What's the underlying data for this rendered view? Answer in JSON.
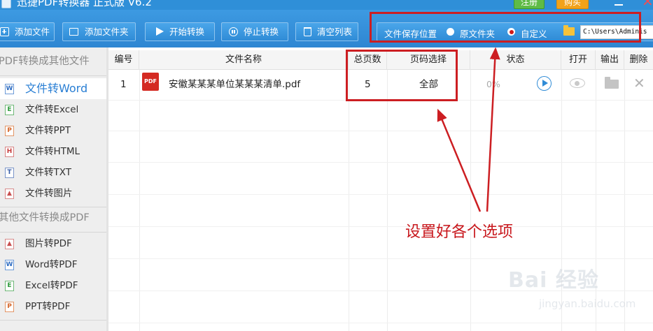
{
  "window": {
    "title": "迅捷PDF转换器 正式版 V6.2",
    "register_label": "注册",
    "buy_label": "购买",
    "close_glyph": "×"
  },
  "toolbar": {
    "add_file": "添加文件",
    "add_folder": "添加文件夹",
    "start": "开始转换",
    "stop": "停止转换",
    "clear": "清空列表",
    "save_location_label": "文件保存位置",
    "option_original": "原文件夹",
    "option_custom": "自定义",
    "selected_option": "自定义",
    "save_path": "C:\\Users\\Adminis"
  },
  "sidebar": {
    "section_pdf_to_other": "PDF转换成其他文件",
    "section_other_to_pdf": "其他文件转换成PDF",
    "items_pdf_to_other": [
      {
        "label": "文件转Word",
        "icon": "word-file-icon",
        "active": true
      },
      {
        "label": "文件转Excel",
        "icon": "excel-file-icon",
        "active": false
      },
      {
        "label": "文件转PPT",
        "icon": "ppt-file-icon",
        "active": false
      },
      {
        "label": "文件转HTML",
        "icon": "html-file-icon",
        "active": false
      },
      {
        "label": "文件转TXT",
        "icon": "txt-file-icon",
        "active": false
      },
      {
        "label": "文件转图片",
        "icon": "image-file-icon",
        "active": false
      }
    ],
    "items_other_to_pdf": [
      {
        "label": "图片转PDF",
        "icon": "image-file-icon"
      },
      {
        "label": "Word转PDF",
        "icon": "word-file-icon"
      },
      {
        "label": "Excel转PDF",
        "icon": "excel-file-icon"
      },
      {
        "label": "PPT转PDF",
        "icon": "ppt-file-icon"
      }
    ]
  },
  "table": {
    "headers": {
      "index": "编号",
      "filename": "文件名称",
      "pages": "总页数",
      "page_select": "页码选择",
      "status": "状态",
      "open": "打开",
      "output": "输出",
      "delete": "删除"
    },
    "rows": [
      {
        "index": "1",
        "filename": "安徽某某某单位某某某清单.pdf",
        "pages": "5",
        "page_select": "全部",
        "progress": "0%",
        "progress_value": 0
      }
    ]
  },
  "annotation": {
    "text": "设置好各个选项",
    "color": "#cc1e22"
  },
  "watermark": {
    "logo": "Bai 经验",
    "url": "jingyan.baidu.com"
  },
  "colors": {
    "accent": "#2f8fd8",
    "active_sidebar_text": "#2a7fd4",
    "register_green": "#5fbb46",
    "buy_orange": "#f2a21a"
  }
}
